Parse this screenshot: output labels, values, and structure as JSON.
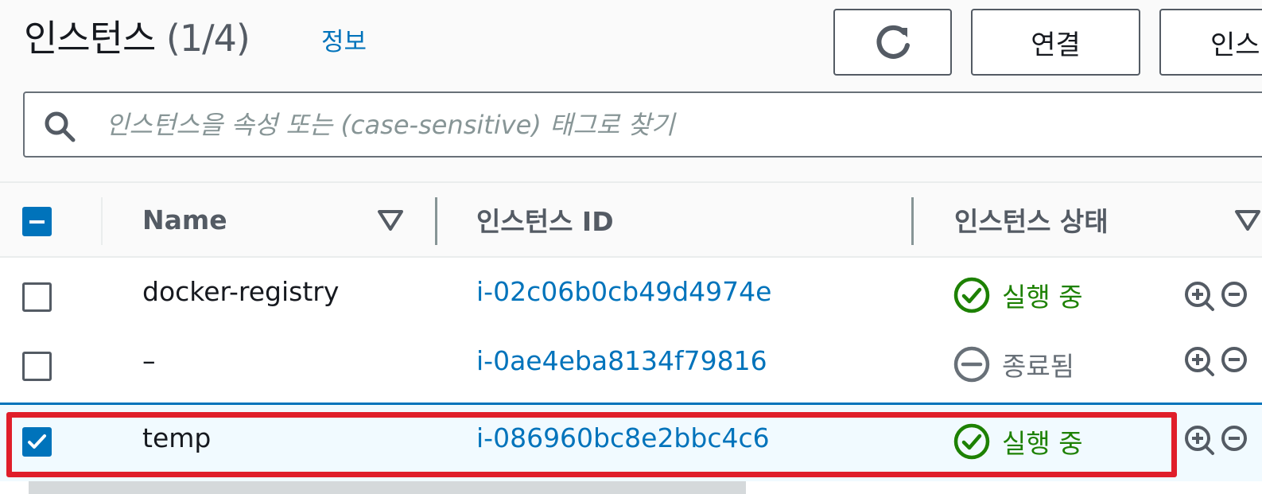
{
  "header": {
    "title": "인스턴스",
    "count": "(1/4)",
    "info_link": "정보"
  },
  "toolbar": {
    "refresh_icon": "refresh-icon",
    "connect_label": "연결",
    "more_label": "인스"
  },
  "search": {
    "placeholder": "인스턴스을 속성 또는 (case-sensitive) 태그로 찾기",
    "value": "",
    "icon": "search-icon"
  },
  "table": {
    "columns": [
      "Name",
      "인스턴스 ID",
      "인스턴스 상태"
    ],
    "rows": [
      {
        "name": "docker-registry",
        "id": "i-02c06b0cb49d4974e",
        "state": "실행 중",
        "state_kind": "running",
        "checked": false
      },
      {
        "name": "–",
        "id": "i-0ae4eba8134f79816",
        "state": "종료됨",
        "state_kind": "terminated",
        "checked": false
      },
      {
        "name": "temp",
        "id": "i-086960bc8e2bbc4c6",
        "state": "실행 중",
        "state_kind": "running",
        "checked": true
      }
    ]
  },
  "colors": {
    "link": "#0073bb",
    "running": "#1d8102",
    "stopped": "#687078",
    "highlight": "#e01e2a",
    "selected_row": "#f1faff"
  }
}
